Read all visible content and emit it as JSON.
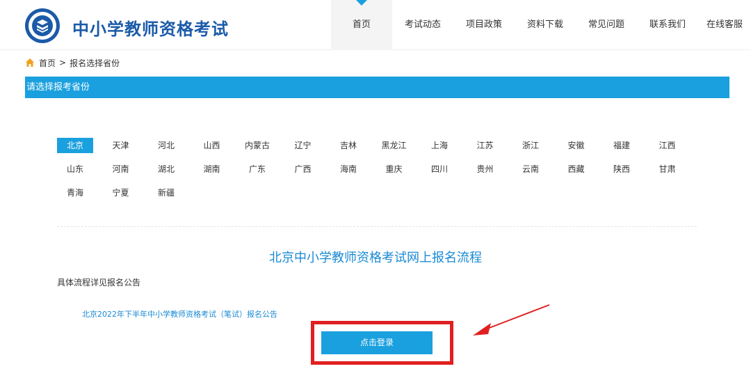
{
  "header": {
    "site_title": "中小学教师资格考试",
    "nav": [
      "首页",
      "考试动态",
      "项目政策",
      "资料下载",
      "常见问题",
      "联系我们",
      "在线客服"
    ],
    "active_nav": 0
  },
  "breadcrumb": {
    "home": "首页",
    "separator": ">",
    "current": "报名选择省份"
  },
  "section": {
    "title": "请选择报考省份"
  },
  "provinces": {
    "rows": [
      [
        "北京",
        "天津",
        "河北",
        "山西",
        "内蒙古",
        "辽宁",
        "吉林",
        "黑龙江",
        "上海",
        "江苏",
        "浙江",
        "安徽",
        "福建",
        "江西"
      ],
      [
        "山东",
        "河南",
        "湖北",
        "湖南",
        "广东",
        "广西",
        "海南",
        "重庆",
        "四川",
        "贵州",
        "云南",
        "西藏",
        "陕西",
        "甘肃"
      ],
      [
        "青海",
        "宁夏",
        "新疆"
      ]
    ],
    "selected": "北京"
  },
  "flow": {
    "title": "北京中小学教师资格考试网上报名流程",
    "subtitle": "具体流程详见报名公告",
    "notice_link": "北京2022年下半年中小学教师资格考试（笔试）报名公告",
    "login_button": "点击登录"
  },
  "colors": {
    "brand_blue": "#1b5aa8",
    "accent_blue": "#1aa0de",
    "highlight_red": "#e02020"
  },
  "icons": {
    "home": "home-icon",
    "logo": "book-emblem-icon",
    "arrow": "red-arrow-icon"
  }
}
